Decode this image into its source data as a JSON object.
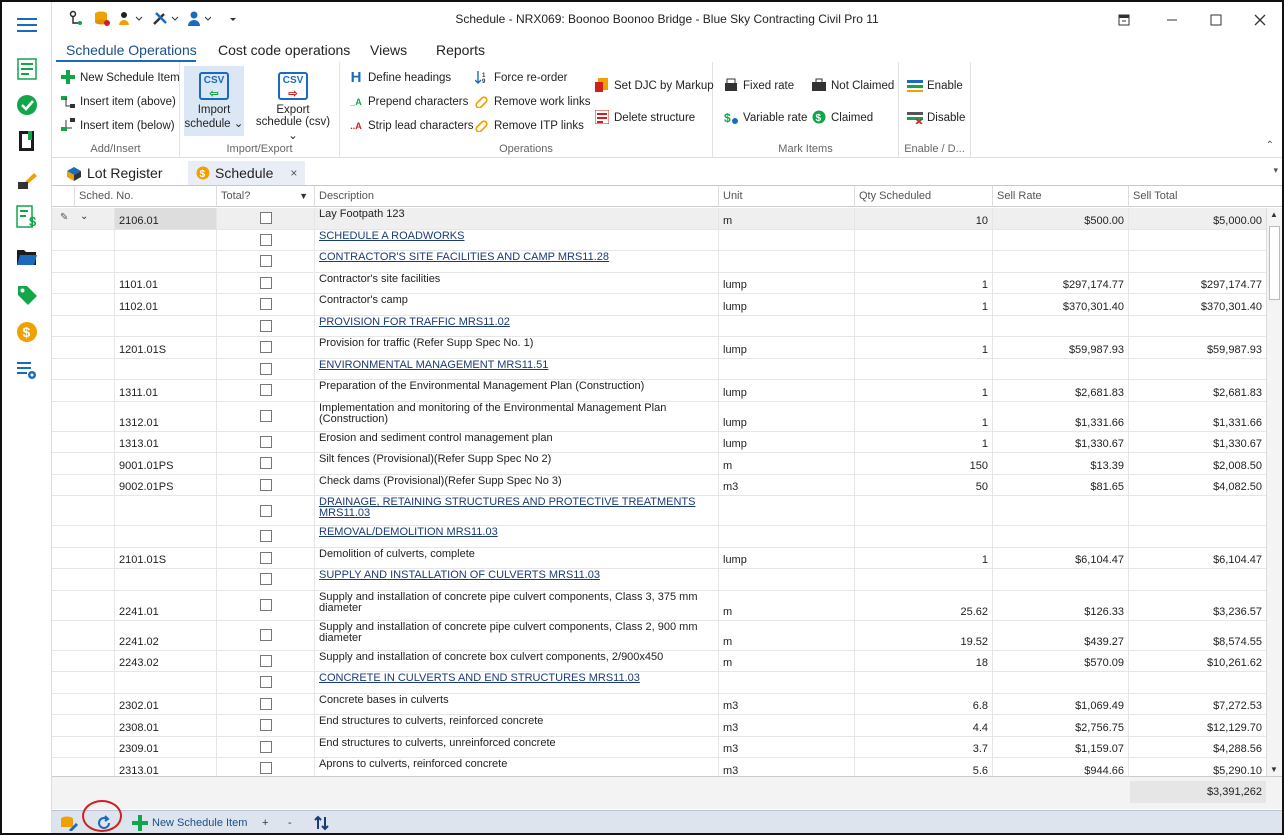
{
  "window": {
    "title": "Schedule - NRX069: Boonoo Boonoo Bridge  - Blue Sky Contracting Civil Pro 11"
  },
  "ribbon_tabs": [
    "Schedule Operations",
    "Cost code operations",
    "Views",
    "Reports"
  ],
  "ribbon": {
    "add_insert": {
      "label": "Add/Insert",
      "new_item": "New Schedule Item",
      "insert_above": "Insert item (above)",
      "insert_below": "Insert item (below)"
    },
    "import_export": {
      "label": "Import/Export",
      "import_l1": "Import",
      "import_l2": "schedule",
      "export_l1": "Export",
      "export_l2": "schedule (csv)",
      "csv": "CSV"
    },
    "operations": {
      "label": "Operations",
      "define_headings": "Define headings",
      "prepend": "Prepend characters",
      "strip": "Strip lead characters",
      "force_reorder": "Force re-order",
      "remove_work": "Remove work links",
      "remove_itp": "Remove ITP links",
      "set_djc": "Set DJC by Markup",
      "delete_structure": "Delete structure"
    },
    "mark_items": {
      "label": "Mark Items",
      "fixed_rate": "Fixed rate",
      "not_claimed": "Not Claimed",
      "variable_rate": "Variable rate",
      "claimed": "Claimed"
    },
    "enable_disable": {
      "label": "Enable / D...",
      "enable": "Enable",
      "disable": "Disable"
    }
  },
  "doc_tabs": [
    {
      "label": "Lot Register",
      "active": false
    },
    {
      "label": "Schedule",
      "active": true
    }
  ],
  "columns": [
    "Sched. No.",
    "Total?",
    "Description",
    "Unit",
    "Qty Scheduled",
    "Sell Rate",
    "Sell Total"
  ],
  "rows": [
    {
      "no": "2106.01",
      "desc": "Lay Footpath  123",
      "unit": "m",
      "qty": "10",
      "rate": "$500.00",
      "total": "$5,000.00",
      "heading": false
    },
    {
      "no": "",
      "desc": "SCHEDULE A ROADWORKS",
      "unit": "",
      "qty": "",
      "rate": "",
      "total": "",
      "heading": true
    },
    {
      "no": "",
      "desc": "CONTRACTOR'S SITE FACILITIES AND CAMP  MRS11.28",
      "unit": "",
      "qty": "",
      "rate": "",
      "total": "",
      "heading": true
    },
    {
      "no": "1101.01",
      "desc": "Contractor's site facilities",
      "unit": "lump",
      "qty": "1",
      "rate": "$297,174.77",
      "total": "$297,174.77",
      "heading": false
    },
    {
      "no": "1102.01",
      "desc": "Contractor's camp",
      "unit": "lump",
      "qty": "1",
      "rate": "$370,301.40",
      "total": "$370,301.40",
      "heading": false
    },
    {
      "no": "",
      "desc": "PROVISION FOR TRAFFIC  MRS11.02",
      "unit": "",
      "qty": "",
      "rate": "",
      "total": "",
      "heading": true
    },
    {
      "no": "1201.01S",
      "desc": "Provision for traffic (Refer Supp Spec No. 1)",
      "unit": "lump",
      "qty": "1",
      "rate": "$59,987.93",
      "total": "$59,987.93",
      "heading": false
    },
    {
      "no": "",
      "desc": "ENVIRONMENTAL MANAGEMENT  MRS11.51",
      "unit": "",
      "qty": "",
      "rate": "",
      "total": "",
      "heading": true
    },
    {
      "no": "1311.01",
      "desc": "Preparation of the Environmental Management Plan (Construction)",
      "unit": "lump",
      "qty": "1",
      "rate": "$2,681.83",
      "total": "$2,681.83",
      "heading": false
    },
    {
      "no": "1312.01",
      "desc": "Implementation and monitoring of the Environmental Management Plan (Construction)",
      "unit": "lump",
      "qty": "1",
      "rate": "$1,331.66",
      "total": "$1,331.66",
      "heading": false,
      "tall": true
    },
    {
      "no": "1313.01",
      "desc": "Erosion and sediment control management plan",
      "unit": "lump",
      "qty": "1",
      "rate": "$1,330.67",
      "total": "$1,330.67",
      "heading": false
    },
    {
      "no": "9001.01PS",
      "desc": "Silt fences (Provisional)(Refer Supp Spec No 2)",
      "unit": "m",
      "qty": "150",
      "rate": "$13.39",
      "total": "$2,008.50",
      "heading": false
    },
    {
      "no": "9002.01PS",
      "desc": "Check dams (Provisional)(Refer Supp Spec No 3)",
      "unit": "m3",
      "qty": "50",
      "rate": "$81.65",
      "total": "$4,082.50",
      "heading": false
    },
    {
      "no": "",
      "desc": "DRAINAGE, RETAINING STRUCTURES AND PROTECTIVE TREATMENTS  MRS11.03",
      "unit": "",
      "qty": "",
      "rate": "",
      "total": "",
      "heading": true,
      "tall": true
    },
    {
      "no": "",
      "desc": "REMOVAL/DEMOLITION  MRS11.03",
      "unit": "",
      "qty": "",
      "rate": "",
      "total": "",
      "heading": true
    },
    {
      "no": "2101.01S",
      "desc": "Demolition of culverts, complete",
      "unit": "lump",
      "qty": "1",
      "rate": "$6,104.47",
      "total": "$6,104.47",
      "heading": false
    },
    {
      "no": "",
      "desc": "SUPPLY AND INSTALLATION OF CULVERTS  MRS11.03",
      "unit": "",
      "qty": "",
      "rate": "",
      "total": "",
      "heading": true
    },
    {
      "no": "2241.01",
      "desc": "Supply and installation of concrete pipe culvert components, Class 3, 375 mm diameter",
      "unit": "m",
      "qty": "25.62",
      "rate": "$126.33",
      "total": "$3,236.57",
      "heading": false,
      "tall": true
    },
    {
      "no": "2241.02",
      "desc": "Supply and installation of concrete pipe culvert components, Class 2, 900 mm diameter",
      "unit": "m",
      "qty": "19.52",
      "rate": "$439.27",
      "total": "$8,574.55",
      "heading": false,
      "tall": true
    },
    {
      "no": "2243.02",
      "desc": "Supply and installation of concrete box culvert components, 2/900x450",
      "unit": "m",
      "qty": "18",
      "rate": "$570.09",
      "total": "$10,261.62",
      "heading": false
    },
    {
      "no": "",
      "desc": "CONCRETE IN CULVERTS AND END STRUCTURES  MRS11.03",
      "unit": "",
      "qty": "",
      "rate": "",
      "total": "",
      "heading": true
    },
    {
      "no": "2302.01",
      "desc": "Concrete bases in culverts",
      "unit": "m3",
      "qty": "6.8",
      "rate": "$1,069.49",
      "total": "$7,272.53",
      "heading": false
    },
    {
      "no": "2308.01",
      "desc": "End structures to culverts, reinforced concrete",
      "unit": "m3",
      "qty": "4.4",
      "rate": "$2,756.75",
      "total": "$12,129.70",
      "heading": false
    },
    {
      "no": "2309.01",
      "desc": "End structures to culverts, unreinforced concrete",
      "unit": "m3",
      "qty": "3.7",
      "rate": "$1,159.07",
      "total": "$4,288.56",
      "heading": false
    },
    {
      "no": "2313.01",
      "desc": "Aprons to culverts, reinforced concrete",
      "unit": "m3",
      "qty": "5.6",
      "rate": "$944.66",
      "total": "$5,290.10",
      "heading": false
    }
  ],
  "footer": {
    "grand_total": "$3,391,262",
    "new_item": "New Schedule Item",
    "plus": "+",
    "minus": "-"
  },
  "colors": {
    "accent": "#1a6bc0",
    "heading_link": "#1a3b78",
    "highlight_ring": "#d0201e",
    "rail_green": "#12a64a",
    "rail_orange": "#f0a000"
  }
}
